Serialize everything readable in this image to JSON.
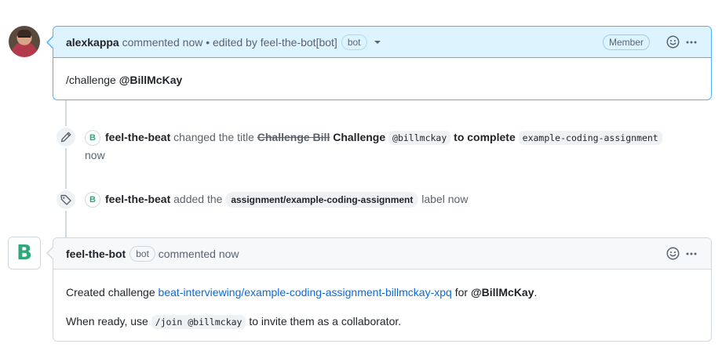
{
  "comment1": {
    "author": "alexkappa",
    "action": "commented",
    "time": "now",
    "edited_prefix": "• edited by",
    "editor": "feel-the-bot[bot]",
    "badge": "bot",
    "role": "Member",
    "body_prefix": "/challenge",
    "body_mention": "@BillMcKay"
  },
  "event1": {
    "actor": "feel-the-beat",
    "text_changed": "changed the title",
    "old_title": "Challenge Bill",
    "new_title_a": "Challenge",
    "new_title_code1": "@billmckay",
    "new_title_b": "to complete",
    "new_title_code2": "example-coding-assignment",
    "time": "now"
  },
  "event2": {
    "actor": "feel-the-beat",
    "text_added": "added the",
    "label": "assignment/example-coding-assignment",
    "text_label": "label",
    "time": "now"
  },
  "comment2": {
    "author": "feel-the-bot",
    "badge": "bot",
    "action": "commented",
    "time": "now",
    "line1_prefix": "Created challenge",
    "line1_link": "beat-interviewing/example-coding-assignment-billmckay-xpq",
    "line1_for": "for",
    "line1_mention": "@BillMcKay",
    "line1_end": ".",
    "line2_prefix": "When ready, use",
    "line2_code": "/join @billmckay",
    "line2_suffix": "to invite them as a collaborator."
  },
  "bot_logo_letter": "B",
  "colors": {
    "accent_blue": "#0969da",
    "highlight_bg": "#ddf4ff",
    "highlight_border": "#54aeff",
    "bot_green": "#2ea87a"
  },
  "icons": {
    "edit_event": "pencil-icon",
    "label_event": "tag-icon",
    "reaction": "smiley-icon",
    "menu": "kebab-horizontal-icon"
  }
}
